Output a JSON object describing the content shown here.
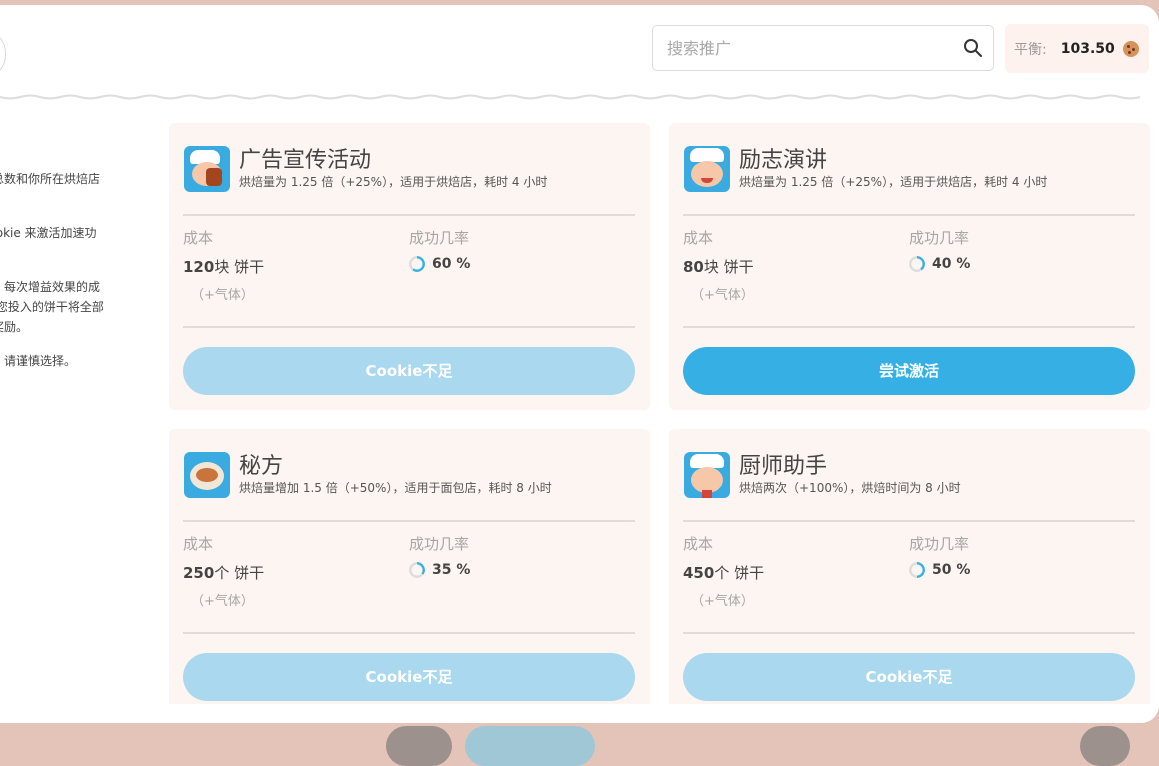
{
  "search": {
    "placeholder": "搜索推广"
  },
  "balance": {
    "label": "平衡:",
    "value": "103.50",
    "icon": "cookie-icon"
  },
  "sidebar": {
    "paragraphs": [
      "人总数和你所在烘焙店\n干。",
      "Cookie 来激活加速功",
      "功。每次增益效果的成\n。 您投入的饼干将全部\n外奖励。",
      "性。请谨慎选择。"
    ]
  },
  "labels": {
    "cost": "成本",
    "success": "成功几率",
    "extra": "（+气体）"
  },
  "colors": {
    "accent": "#36b0e4",
    "disabled": "#aad8ee",
    "card_bg": "#fdf5f1"
  },
  "cards": [
    {
      "title": "广告宣传活动",
      "desc": "烘焙量为 1.25 倍（+25%），适用于烘焙店，耗时 4 小时",
      "cost_amount": "120",
      "cost_unit": "块 饼干",
      "probability": "60 %",
      "probability_value": 0.6,
      "button": "Cookie不足",
      "button_state": "disabled"
    },
    {
      "title": "励志演讲",
      "desc": "烘焙量为 1.25 倍（+25%），适用于烘焙店，耗时 4 小时",
      "cost_amount": "80",
      "cost_unit": "块 饼干",
      "probability": "40 %",
      "probability_value": 0.4,
      "button": "尝试激活",
      "button_state": "active"
    },
    {
      "title": "秘方",
      "desc": "烘焙量增加 1.5 倍（+50%），适用于面包店，耗时 8 小时",
      "cost_amount": "250",
      "cost_unit": "个 饼干",
      "probability": "35 %",
      "probability_value": 0.35,
      "button": "Cookie不足",
      "button_state": "disabled"
    },
    {
      "title": "厨师助手",
      "desc": "烘焙两次（+100%），烘焙时间为 8 小时",
      "cost_amount": "450",
      "cost_unit": "个 饼干",
      "probability": "50 %",
      "probability_value": 0.5,
      "button": "Cookie不足",
      "button_state": "disabled"
    }
  ]
}
